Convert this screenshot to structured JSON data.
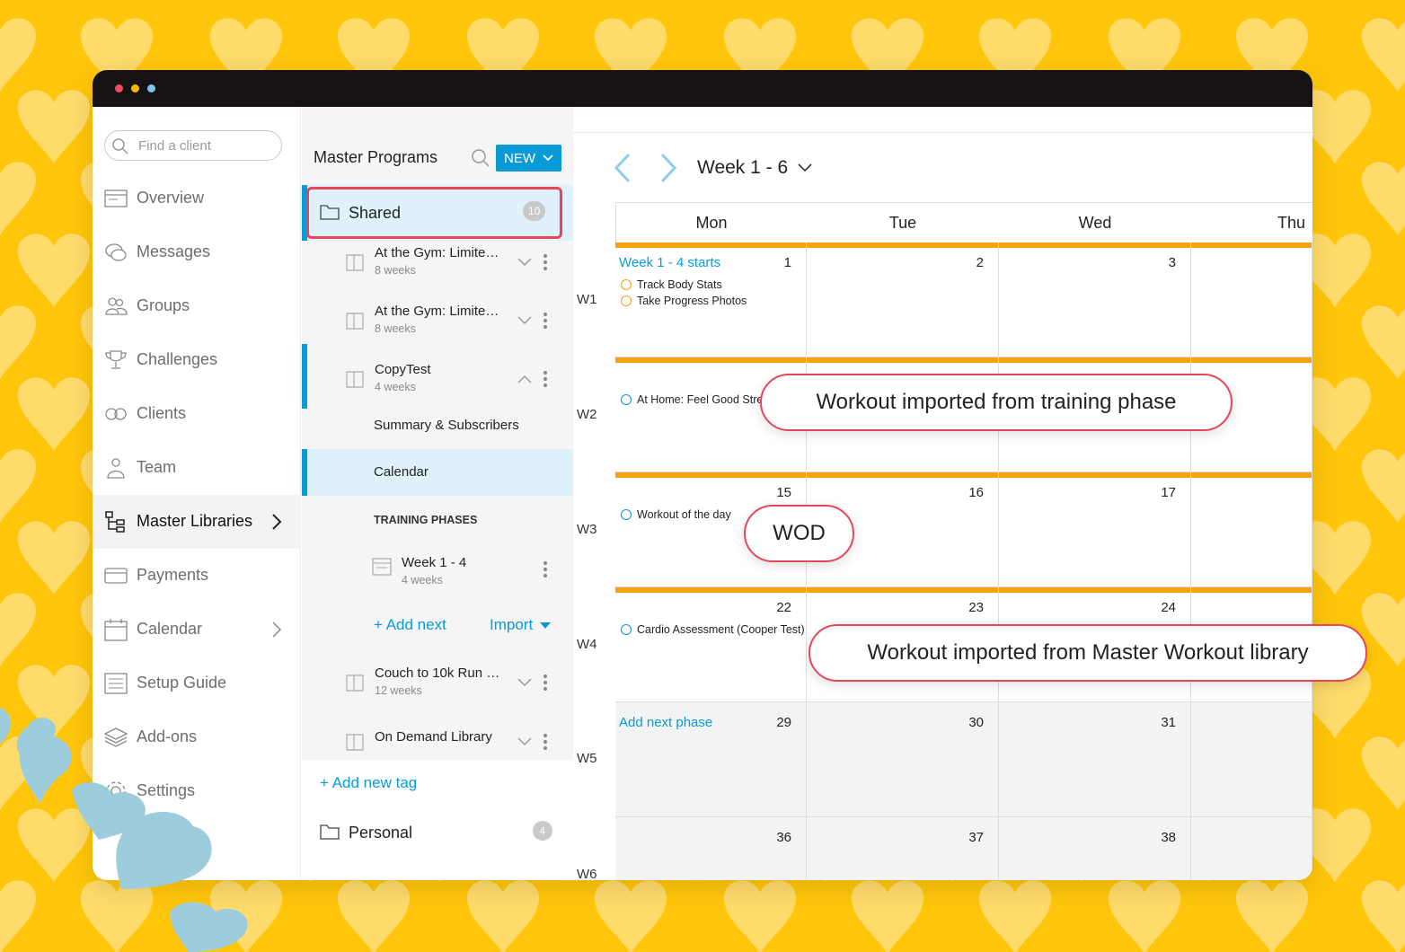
{
  "colors": {
    "background": "#FFC60B",
    "accent": "#0a9ad8",
    "phase_bar": "#F7A310",
    "callout_border": "#E6465A"
  },
  "sidebar": {
    "search_placeholder": "Find a client",
    "items": [
      {
        "label": "Overview",
        "icon": "overview-icon"
      },
      {
        "label": "Messages",
        "icon": "messages-icon"
      },
      {
        "label": "Groups",
        "icon": "groups-icon"
      },
      {
        "label": "Challenges",
        "icon": "trophy-icon"
      },
      {
        "label": "Clients",
        "icon": "clients-icon"
      },
      {
        "label": "Team",
        "icon": "team-icon"
      },
      {
        "label": "Master Libraries",
        "icon": "hierarchy-icon",
        "active": true
      },
      {
        "label": "Payments",
        "icon": "credit-card-icon"
      },
      {
        "label": "Calendar",
        "icon": "calendar-icon"
      },
      {
        "label": "Setup Guide",
        "icon": "list-icon"
      },
      {
        "label": "Add-ons",
        "icon": "layers-icon"
      },
      {
        "label": "Settings",
        "icon": "gear-icon"
      }
    ]
  },
  "middle": {
    "title": "Master Programs",
    "new_label": "NEW",
    "shared_folder": {
      "name": "Shared",
      "count": "10"
    },
    "programs": [
      {
        "name": "At the Gym: Limite…",
        "sub": "8 weeks"
      },
      {
        "name": "At the Gym: Limite…",
        "sub": "8 weeks"
      },
      {
        "name": "CopyTest",
        "sub": "4 weeks"
      }
    ],
    "copytest_links": {
      "summary": "Summary & Subscribers",
      "calendar": "Calendar"
    },
    "training_phases_heading": "TRAINING PHASES",
    "phase": {
      "name": "Week 1 - 4",
      "sub": "4 weeks"
    },
    "add_next": "+ Add next",
    "import": "Import",
    "more_programs": [
      {
        "name": "Couch to 10k Run …",
        "sub": "12 weeks"
      },
      {
        "name": "On Demand Library",
        "sub": ""
      }
    ],
    "add_new_tag": "+ Add new tag",
    "personal_folder": {
      "name": "Personal",
      "count": "4"
    }
  },
  "calendar": {
    "week_range": "Week 1 - 6",
    "days": [
      "Mon",
      "Tue",
      "Wed",
      "Thu"
    ],
    "weeks": [
      "W1",
      "W2",
      "W3",
      "W4",
      "W5",
      "W6"
    ],
    "w1": {
      "phase": "Week 1 - 4 starts",
      "dates": [
        "1",
        "2",
        "3"
      ],
      "tasks": [
        "Track Body Stats",
        "Take Progress Photos"
      ]
    },
    "w2": {
      "workout": "At Home: Feel Good Stretch"
    },
    "w3": {
      "dates": [
        "15",
        "16",
        "17"
      ],
      "workout": "Workout of the day"
    },
    "w4": {
      "dates": [
        "22",
        "23",
        "24"
      ],
      "workout": "Cardio Assessment (Cooper Test)"
    },
    "w5": {
      "phase": "Add next phase",
      "dates": [
        "29",
        "30",
        "31"
      ]
    },
    "w6": {
      "dates": [
        "36",
        "37",
        "38"
      ]
    }
  },
  "callouts": {
    "training_phase": "Workout imported from training phase",
    "wod": "WOD",
    "master_library": "Workout imported from Master Workout library"
  }
}
